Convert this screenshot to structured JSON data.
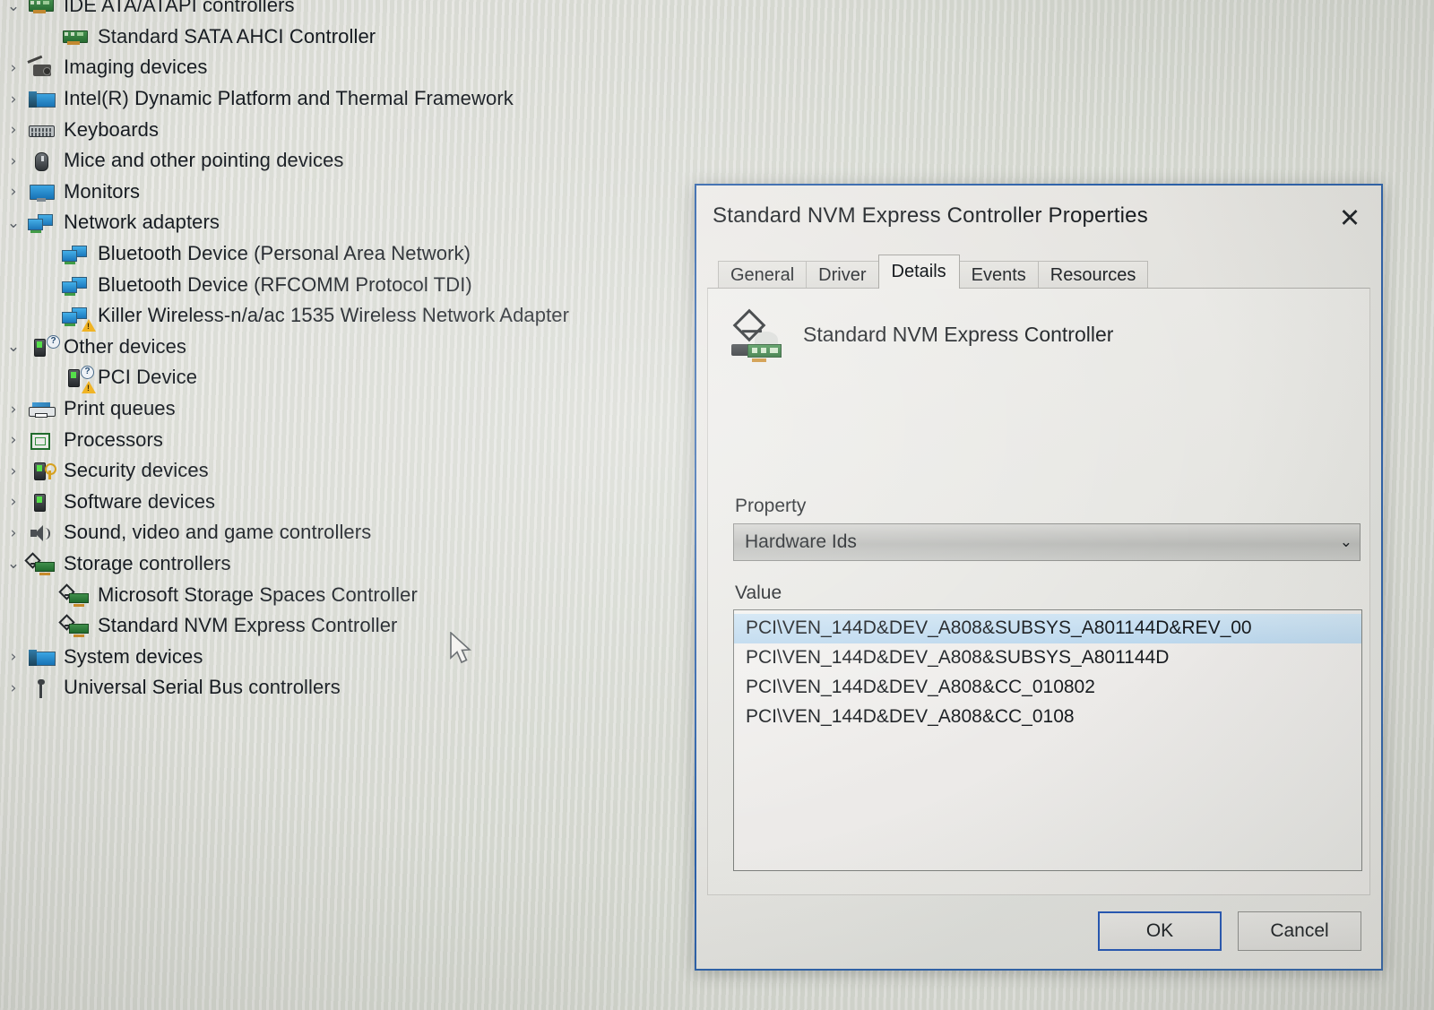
{
  "window": {
    "app": "Device Manager",
    "cursor": "arrow-cursor"
  },
  "device_tree": {
    "items": [
      {
        "label": "IDE ATA/ATAPI controllers",
        "level": 1,
        "expander": "⌄",
        "expanded": true,
        "icon": "ide-controller-icon"
      },
      {
        "label": "Standard SATA AHCI Controller",
        "level": 2,
        "expander": "",
        "expanded": false,
        "icon": "ide-controller-icon"
      },
      {
        "label": "Imaging devices",
        "level": 1,
        "expander": "›",
        "expanded": false,
        "icon": "camera-icon"
      },
      {
        "label": "Intel(R) Dynamic Platform and Thermal Framework",
        "level": 1,
        "expander": "›",
        "expanded": false,
        "icon": "system-device-icon"
      },
      {
        "label": "Keyboards",
        "level": 1,
        "expander": "›",
        "expanded": false,
        "icon": "keyboard-icon"
      },
      {
        "label": "Mice and other pointing devices",
        "level": 1,
        "expander": "›",
        "expanded": false,
        "icon": "mouse-icon"
      },
      {
        "label": "Monitors",
        "level": 1,
        "expander": "›",
        "expanded": false,
        "icon": "monitor-icon"
      },
      {
        "label": "Network adapters",
        "level": 1,
        "expander": "⌄",
        "expanded": true,
        "icon": "network-adapter-icon"
      },
      {
        "label": "Bluetooth Device (Personal Area Network)",
        "level": 2,
        "expander": "",
        "expanded": false,
        "icon": "network-adapter-icon"
      },
      {
        "label": "Bluetooth Device (RFCOMM Protocol TDI)",
        "level": 2,
        "expander": "",
        "expanded": false,
        "icon": "network-adapter-icon"
      },
      {
        "label": "Killer Wireless-n/a/ac 1535 Wireless Network Adapter",
        "level": 2,
        "expander": "",
        "expanded": false,
        "icon": "network-adapter-warning-icon"
      },
      {
        "label": "Other devices",
        "level": 1,
        "expander": "⌄",
        "expanded": true,
        "icon": "unknown-device-icon"
      },
      {
        "label": "PCI Device",
        "level": 2,
        "expander": "",
        "expanded": false,
        "icon": "unknown-device-warning-icon"
      },
      {
        "label": "Print queues",
        "level": 1,
        "expander": "›",
        "expanded": false,
        "icon": "printer-icon"
      },
      {
        "label": "Processors",
        "level": 1,
        "expander": "›",
        "expanded": false,
        "icon": "processor-icon"
      },
      {
        "label": "Security devices",
        "level": 1,
        "expander": "›",
        "expanded": false,
        "icon": "security-device-icon"
      },
      {
        "label": "Software devices",
        "level": 1,
        "expander": "›",
        "expanded": false,
        "icon": "software-device-icon"
      },
      {
        "label": "Sound, video and game controllers",
        "level": 1,
        "expander": "›",
        "expanded": false,
        "icon": "speaker-icon"
      },
      {
        "label": "Storage controllers",
        "level": 1,
        "expander": "⌄",
        "expanded": true,
        "icon": "storage-controller-icon"
      },
      {
        "label": "Microsoft Storage Spaces Controller",
        "level": 2,
        "expander": "",
        "expanded": false,
        "icon": "storage-controller-icon"
      },
      {
        "label": "Standard NVM Express Controller",
        "level": 2,
        "expander": "",
        "expanded": false,
        "icon": "storage-controller-icon"
      },
      {
        "label": "System devices",
        "level": 1,
        "expander": "›",
        "expanded": false,
        "icon": "system-device-icon"
      },
      {
        "label": "Universal Serial Bus controllers",
        "level": 1,
        "expander": "›",
        "expanded": false,
        "icon": "usb-icon"
      }
    ]
  },
  "dialog": {
    "title": "Standard NVM Express Controller Properties",
    "close_label": "✕",
    "tabs": [
      {
        "label": "General",
        "active": false
      },
      {
        "label": "Driver",
        "active": false
      },
      {
        "label": "Details",
        "active": true
      },
      {
        "label": "Events",
        "active": false
      },
      {
        "label": "Resources",
        "active": false
      }
    ],
    "device_name": "Standard NVM Express Controller",
    "device_icon": "pci-card-icon",
    "property": {
      "label": "Property",
      "selected": "Hardware Ids",
      "caret": "⌄"
    },
    "value": {
      "label": "Value",
      "rows": [
        {
          "text": "PCI\\VEN_144D&DEV_A808&SUBSYS_A801144D&REV_00",
          "selected": true
        },
        {
          "text": "PCI\\VEN_144D&DEV_A808&SUBSYS_A801144D",
          "selected": false
        },
        {
          "text": "PCI\\VEN_144D&DEV_A808&CC_010802",
          "selected": false
        },
        {
          "text": "PCI\\VEN_144D&DEV_A808&CC_0108",
          "selected": false
        }
      ]
    },
    "buttons": {
      "ok": "OK",
      "cancel": "Cancel"
    },
    "colors": {
      "border": "#2a5fa8",
      "selection": "#c6dff0",
      "default_button_border": "#1f53b5"
    }
  }
}
